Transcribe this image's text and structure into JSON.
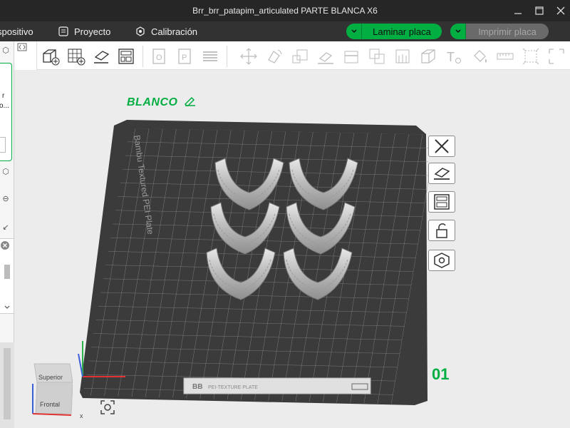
{
  "window": {
    "title": "Brr_brr_patapim_articulated PARTE BLANCA X6"
  },
  "menu": {
    "device_label": "spositivo",
    "project_label": "Proyecto",
    "calibration_label": "Calibración"
  },
  "actions": {
    "slice_label": "Laminar placa",
    "print_label": "Imprimir placa"
  },
  "plate": {
    "name": "BLANCO",
    "number": "01",
    "surface_label": "Bambu Textured PEI Plate",
    "strip_label": "PEI-TEXTURE PLATE"
  },
  "sidebar": {
    "printer_text_1": "r",
    "printer_text_2": "o..."
  },
  "view_cube": {
    "top": "Superior",
    "front": "Frontal",
    "x_axis": "x"
  },
  "colors": {
    "accent": "#00ae42",
    "titlebar": "#262626",
    "menubar": "#323232",
    "plate": "#3b3b3b"
  }
}
